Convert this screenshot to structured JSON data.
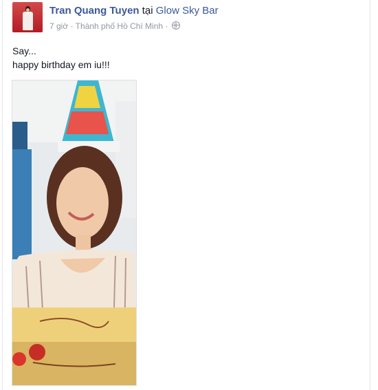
{
  "post": {
    "author": "Tran Quang Tuyen",
    "at_word": "tại",
    "place": "Glow Sky Bar",
    "time": "7 giờ",
    "separator": "·",
    "city": "Thành phố Hồ Chí Minh",
    "separator2": "·",
    "privacy_icon": "globe-icon",
    "lines": [
      "Say...",
      "happy birthday em iu!!!"
    ]
  },
  "colors": {
    "link_blue": "#3b5998",
    "meta_gray": "#9197a3",
    "text": "#141823"
  }
}
